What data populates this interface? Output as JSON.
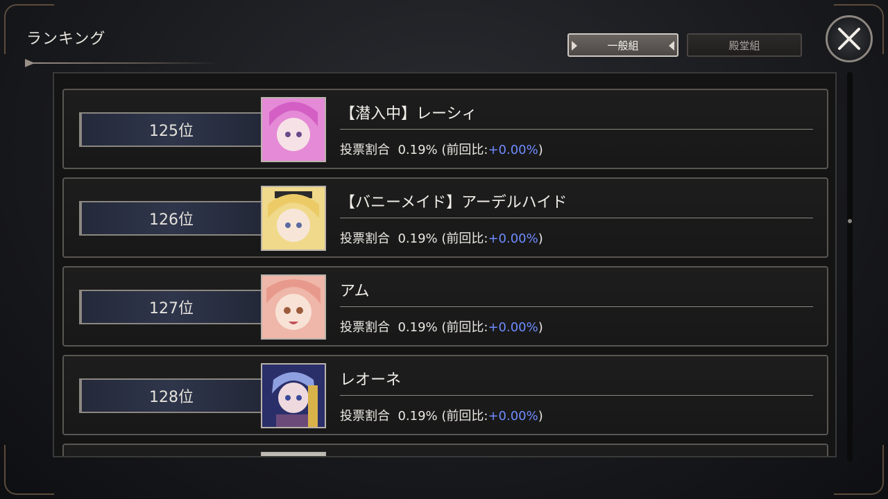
{
  "screen": {
    "title": "ランキング"
  },
  "tabs": [
    {
      "label": "一般組",
      "active": true
    },
    {
      "label": "殿堂組",
      "active": false
    }
  ],
  "close": {
    "icon": "close-x-icon"
  },
  "rows": [
    {
      "rank": "125位",
      "name": "【潜入中】レーシィ",
      "stat_label": "投票割合",
      "ratio": "0.19%",
      "prev_prefix": "(前回比:",
      "delta": "+0.00%",
      "prev_suffix": ")",
      "portrait_color": "#e58ad6"
    },
    {
      "rank": "126位",
      "name": "【バニーメイド】アーデルハイド",
      "stat_label": "投票割合",
      "ratio": "0.19%",
      "prev_prefix": "(前回比:",
      "delta": "+0.00%",
      "prev_suffix": ")",
      "portrait_color": "#f0d98a"
    },
    {
      "rank": "127位",
      "name": "アム",
      "stat_label": "投票割合",
      "ratio": "0.19%",
      "prev_prefix": "(前回比:",
      "delta": "+0.00%",
      "prev_suffix": ")",
      "portrait_color": "#efb7a9"
    },
    {
      "rank": "128位",
      "name": "レオーネ",
      "stat_label": "投票割合",
      "ratio": "0.19%",
      "prev_prefix": "(前回比:",
      "delta": "+0.00%",
      "prev_suffix": ")",
      "portrait_color": "#8fa0e0"
    }
  ],
  "colors": {
    "delta": "#6f8cff",
    "accent_border": "#8c8781"
  }
}
